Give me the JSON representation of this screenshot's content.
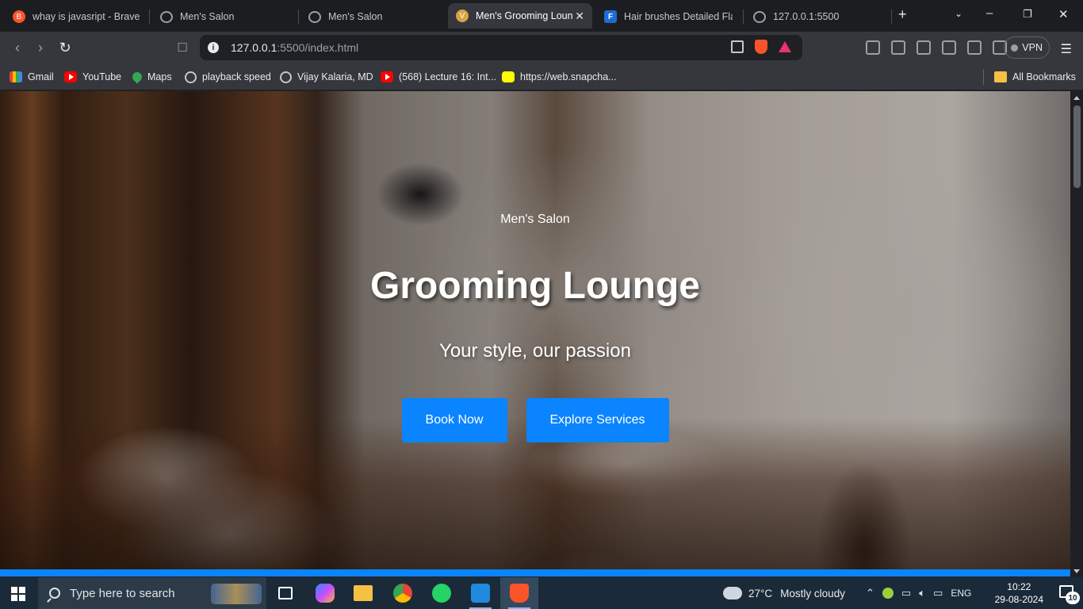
{
  "browser": {
    "tabs": [
      {
        "title": "whay is javasript - Brave S",
        "icon": "brave-search-icon"
      },
      {
        "title": "Men's Salon",
        "icon": "globe-icon"
      },
      {
        "title": "Men's Salon",
        "icon": "globe-icon"
      },
      {
        "title": "Men's Grooming Loun",
        "icon": "salon-favicon",
        "active": true
      },
      {
        "title": "Hair brushes Detailed Flat",
        "icon": "flaticon-icon"
      },
      {
        "title": "127.0.0.1:5500",
        "icon": "globe-icon"
      }
    ],
    "new_tab_symbol": "+",
    "address": {
      "host": "127.0.0.1",
      "rest": ":5500/index.html"
    },
    "vpn_label": "VPN",
    "bookmarks": [
      {
        "label": "Gmail",
        "icon": "gmail-icon"
      },
      {
        "label": "YouTube",
        "icon": "youtube-icon"
      },
      {
        "label": "Maps",
        "icon": "maps-icon"
      },
      {
        "label": "playback speed",
        "icon": "globe-icon"
      },
      {
        "label": "Vijay Kalaria, MD",
        "icon": "globe-icon"
      },
      {
        "label": "(568) Lecture 16: Int...",
        "icon": "youtube-icon"
      },
      {
        "label": "https://web.snapcha...",
        "icon": "snapchat-icon"
      }
    ],
    "all_bookmarks_label": "All Bookmarks"
  },
  "page": {
    "kicker": "Men's Salon",
    "title": "Grooming Lounge",
    "tagline": "Your style, our passion",
    "primary_button": "Book Now",
    "secondary_button": "Explore Services",
    "accent_color": "#0a84ff"
  },
  "taskbar": {
    "search_placeholder": "Type here to search",
    "weather_temp": "27°C",
    "weather_desc": "Mostly cloudy",
    "language": "ENG",
    "time": "10:22",
    "date": "29-08-2024",
    "notifications_count": "10"
  }
}
